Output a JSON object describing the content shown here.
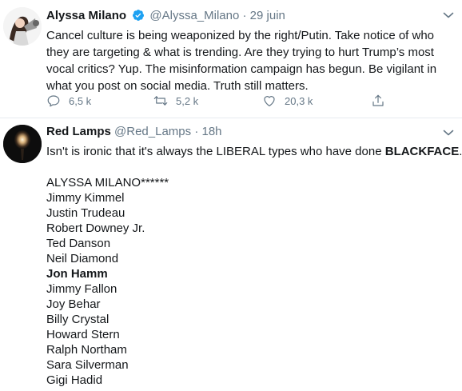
{
  "tweet1": {
    "name": "Alyssa Milano",
    "handle": "@Alyssa_Milano",
    "separator": "·",
    "time": "29 juin",
    "lines": [
      "Cancel culture is being weaponized by the right/Putin. Take notice of who",
      "they are targeting & what is trending. Are they trying to hurt Trump’s most",
      "vocal critics? Yup. The misinformation campaign has begun. Be vigilant in",
      "what you post on social media. Truth still matters."
    ],
    "reply_count": "6,5 k",
    "retweet_count": "5,2 k",
    "like_count": "20,3 k"
  },
  "tweet2": {
    "name": "Red Lamps",
    "handle": "@Red_Lamps",
    "separator": "·",
    "time": "18h",
    "line1_prefix": "Isn't is ironic that it's always the LIBERAL types who have done ",
    "line1_bold": "BLACKFACE",
    "line1_suffix": ".",
    "names": [
      "ALYSSA MILANO******",
      "Jimmy Kimmel",
      "Justin Trudeau",
      "Robert Downey Jr.",
      "Ted Danson",
      "Neil Diamond",
      "Jon Hamm",
      "Jimmy Fallon",
      "Joy Behar",
      "Billy Crystal",
      "Howard Stern",
      "Ralph Northam",
      "Sara Silverman",
      "Gigi Hadid"
    ],
    "bold_name": "Jon Hamm"
  },
  "colors": {
    "text": "#14171a",
    "secondary": "#657786",
    "verified": "#1da1f2",
    "divider": "#e6ecf0"
  }
}
